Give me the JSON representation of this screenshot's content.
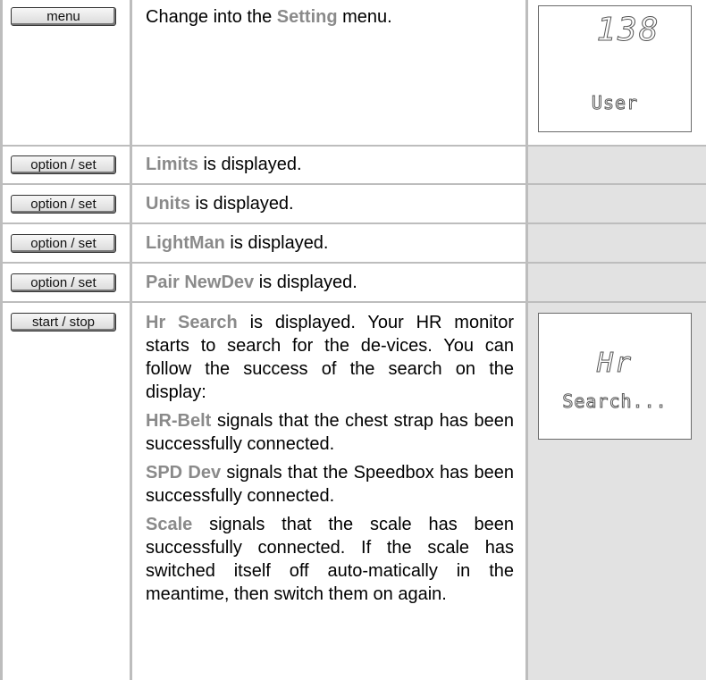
{
  "rows": [
    {
      "button": "menu",
      "text": {
        "pre": "Change into the ",
        "kw": "Setting",
        "post": " menu."
      },
      "display": {
        "line1": "138",
        "line2": "User"
      }
    },
    {
      "button": "option / set",
      "text": {
        "kw": "Limits",
        "post": " is displayed."
      }
    },
    {
      "button": "option / set",
      "text": {
        "kw": "Units",
        "post": " is displayed."
      }
    },
    {
      "button": "option / set",
      "text": {
        "kw": "LightMan",
        "post": " is displayed."
      }
    },
    {
      "button": "option / set",
      "text": {
        "kw": "Pair NewDev",
        "post": " is displayed."
      }
    },
    {
      "button": "start / stop",
      "paragraphs": [
        {
          "kw": "Hr Search",
          "post": " is displayed. Your HR monitor starts to search for the de-vices. You can follow the success of the search on the display:"
        },
        {
          "kw": "HR-Belt",
          "post": " signals that the chest strap has been successfully connected."
        },
        {
          "kw": "SPD Dev",
          "post": " signals that the Speedbox has been successfully connected."
        },
        {
          "kw": "Scale",
          "post": " signals that the scale has been successfully connected. If the scale has switched itself off auto-matically in the meantime, then switch them on again."
        }
      ],
      "display": {
        "line1": "Hr",
        "line2": "Search..."
      }
    }
  ]
}
